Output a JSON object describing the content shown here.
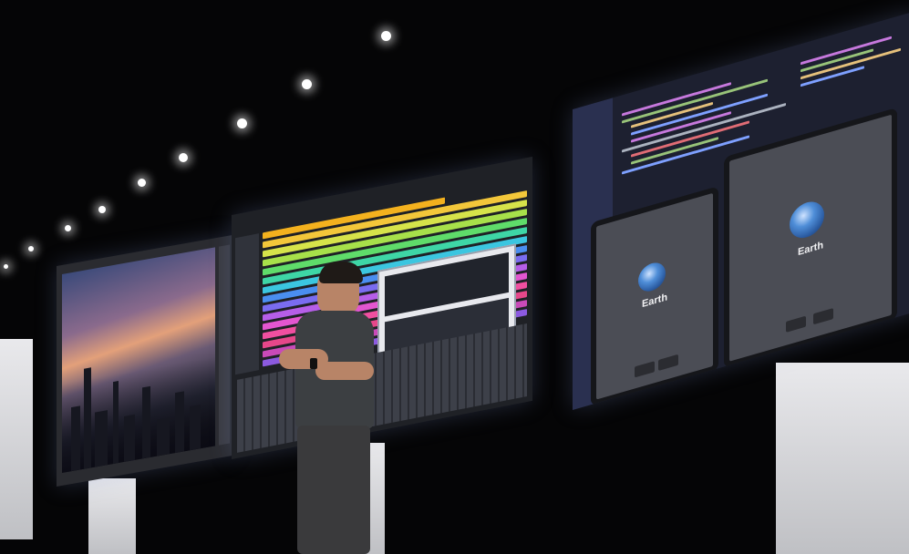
{
  "scene": {
    "description_colors": {
      "background": "#050506",
      "wall": "#e9e9ec",
      "accent_daw": "#f3b11e",
      "accent_code": "#7ea0ff"
    }
  },
  "screens": {
    "code_panel": {
      "preview_left": {
        "label": "Earth"
      },
      "preview_right": {
        "label": "Earth"
      }
    }
  }
}
